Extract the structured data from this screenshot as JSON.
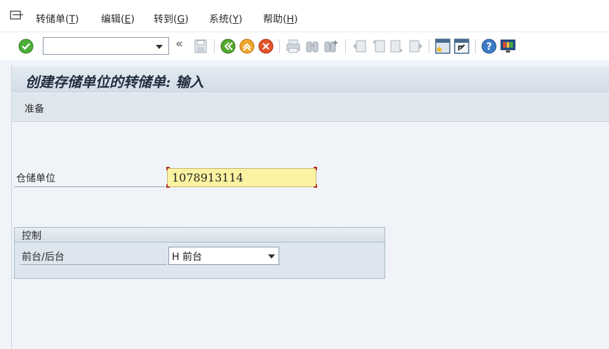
{
  "menubar": {
    "items": [
      {
        "label": "转储单",
        "accel": "T"
      },
      {
        "label": "编辑",
        "accel": "E"
      },
      {
        "label": "转到",
        "accel": "G"
      },
      {
        "label": "系统",
        "accel": "Y"
      },
      {
        "label": "帮助",
        "accel": "H"
      }
    ]
  },
  "toolbar": {
    "command_field": {
      "value": ""
    },
    "icons": [
      "enter-icon",
      "save-icon",
      "back-icon",
      "exit-icon",
      "cancel-icon",
      "print-icon",
      "find-icon",
      "find-next-icon",
      "first-page-icon",
      "previous-page-icon",
      "next-page-icon",
      "last-page-icon",
      "new-session-icon",
      "shortcut-icon",
      "help-icon",
      "customize-layout-icon"
    ]
  },
  "screen": {
    "title": "创建存储单位的转储单: 输入",
    "section": "准备"
  },
  "form": {
    "storage_unit": {
      "label": "仓储单位",
      "value": "1078913114"
    },
    "control_group": {
      "title": "控制",
      "foreground_background": {
        "label": "前台/后台",
        "value": "H 前台"
      }
    }
  },
  "colors": {
    "input_highlight": "#fbf3a1",
    "title_bar": "#d3dde7",
    "background": "#f0f4f8"
  }
}
